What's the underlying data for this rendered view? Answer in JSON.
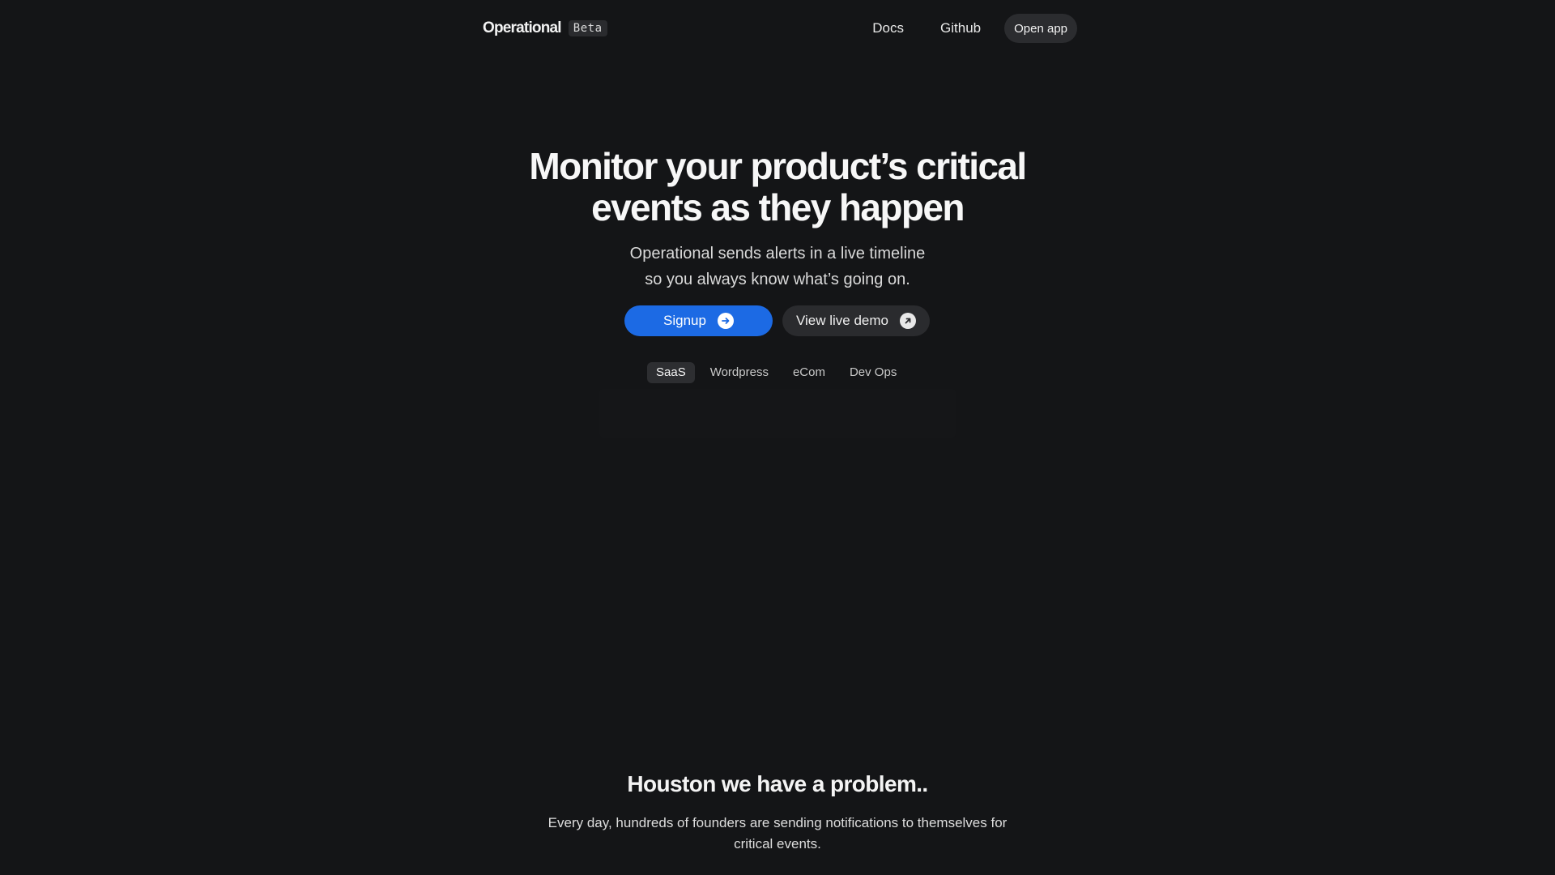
{
  "nav": {
    "brand": "Operational",
    "badge": "Beta",
    "links": [
      "Docs",
      "Github"
    ],
    "open_app": "Open app"
  },
  "hero": {
    "title_line1": "Monitor your product’s critical",
    "title_line2": "events as they happen",
    "subtitle_line1": "Operational sends alerts in a live timeline",
    "subtitle_line2": "so you always know what’s going on."
  },
  "cta": {
    "signup": "Signup",
    "signup_icon": "arrow-right-circle-icon",
    "demo": "View live demo",
    "demo_icon": "arrow-up-right-circle-icon"
  },
  "tabs": {
    "items": [
      "SaaS",
      "Wordpress",
      "eCom",
      "Dev Ops"
    ],
    "active": "SaaS"
  },
  "problem": {
    "title": "Houston we have a problem..",
    "text": "Every day, hundreds of founders are sending notifications to themselves for critical events."
  },
  "colors": {
    "background": "#141517",
    "accent": "#1c6ae4",
    "pill": "#2a2b2e"
  }
}
